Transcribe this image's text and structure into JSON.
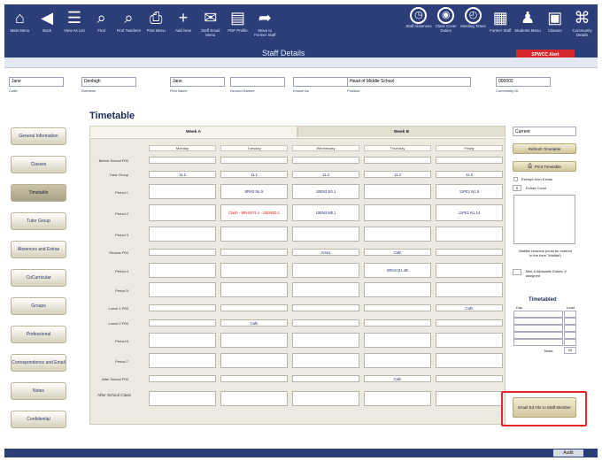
{
  "toolbar": {
    "buttons": [
      {
        "label": "Main Menu",
        "icon": "home-icon"
      },
      {
        "label": "Back",
        "icon": "back-icon"
      },
      {
        "label": "View As List",
        "icon": "list-icon"
      },
      {
        "label": "Find",
        "icon": "search-icon"
      },
      {
        "label": "Find Teachers",
        "icon": "search-plus-icon"
      },
      {
        "label": "Print Menu",
        "icon": "print-icon"
      },
      {
        "label": "Add New",
        "icon": "plus-icon"
      },
      {
        "label": "Staff Email Menu",
        "icon": "mail-icon"
      },
      {
        "label": "PDF Profile",
        "icon": "pdf-icon"
      },
      {
        "label": "Move to Former Staff",
        "icon": "share-arrow-icon"
      },
      {
        "label": "Staff Absences",
        "icon": "clock-icon"
      },
      {
        "label": "Class Cover Duties",
        "icon": "globe-icon"
      },
      {
        "label": "Meeting Times",
        "icon": "meeting-clock-icon"
      },
      {
        "label": "Former Staff",
        "icon": "former-staff-icon"
      },
      {
        "label": "Students Menu",
        "icon": "students-icon"
      },
      {
        "label": "Classes",
        "icon": "classes-icon"
      },
      {
        "label": "Community Details",
        "icon": "community-icon"
      }
    ],
    "title": "Staff Details",
    "alert_label": "SPWCC Alert"
  },
  "header": {
    "fields": [
      {
        "value": "Jane",
        "caption": "Code"
      },
      {
        "value": "Denbigh",
        "caption": "Surname"
      },
      {
        "value": "Jane",
        "caption": "First Name"
      },
      {
        "value": "",
        "caption": "Second Names"
      },
      {
        "value": "",
        "caption": "Known As"
      },
      {
        "value": "Head of Middle School",
        "caption": "Position"
      },
      {
        "value": "000002",
        "caption": "Community ID"
      }
    ]
  },
  "sidebar": {
    "items": [
      {
        "label": "General Information"
      },
      {
        "label": "Classes"
      },
      {
        "label": "Timetable"
      },
      {
        "label": "Tutor Group"
      },
      {
        "label": "Absences and Extras"
      },
      {
        "label": "CoCurricular"
      },
      {
        "label": "Groups"
      },
      {
        "label": "Professional"
      },
      {
        "label": "Correspondence and Email"
      },
      {
        "label": "Notes"
      },
      {
        "label": "Confidential"
      }
    ]
  },
  "timetable": {
    "title": "Timetable",
    "week_tabs": [
      "Week A",
      "Week B"
    ],
    "days": [
      "Monday",
      "Tuesday",
      "Wednesday",
      "Thursday",
      "Friday"
    ],
    "rows": [
      {
        "label": "Before School P00",
        "cells": [
          "",
          "",
          "",
          "",
          ""
        ]
      },
      {
        "label": "Tutor Group",
        "cells": [
          "11.2",
          "11.1",
          "11.2",
          "11.2",
          "11.2"
        ]
      },
      {
        "label": "Period 1",
        "cells": [
          "",
          "8RH2 NL.5",
          "10EN3 E0.1",
          "",
          "11PE1 N1.5"
        ]
      },
      {
        "label": "Period 2",
        "cells": [
          "",
          "Clash - 8RH3 P2.4 - 10EN3D.1",
          "10EN3 M0.1",
          "",
          "11PE1 N1.14"
        ]
      },
      {
        "label": "Period 3",
        "cells": [
          "",
          "",
          "",
          "",
          ""
        ]
      },
      {
        "label": "Recess P00",
        "cells": [
          "",
          "",
          "Area1",
          "Cafe",
          ""
        ]
      },
      {
        "label": "Period 4",
        "cells": [
          "",
          "",
          "",
          "8RH3 Q1.4B",
          ""
        ]
      },
      {
        "label": "Period 5",
        "cells": [
          "",
          "",
          "",
          "",
          ""
        ]
      },
      {
        "label": "Lunch 1 P00",
        "cells": [
          "",
          "",
          "",
          "",
          "Cafe"
        ]
      },
      {
        "label": "Lunch 2 P00",
        "cells": [
          "",
          "Cafe",
          "",
          "",
          ""
        ]
      },
      {
        "label": "Period 6",
        "cells": [
          "",
          "",
          "",
          "",
          ""
        ]
      },
      {
        "label": "Period 7",
        "cells": [
          "",
          "",
          "",
          "",
          ""
        ]
      },
      {
        "label": "After School P00",
        "cells": [
          "",
          "",
          "",
          "Cafe",
          ""
        ]
      },
      {
        "label": "After School Class",
        "cells": [
          "",
          "",
          "",
          "",
          ""
        ]
      }
    ]
  },
  "right_panel": {
    "current_value": "Current",
    "refresh_label": "Refresh Timetable",
    "print_label": "Print Timetable",
    "exempt_label": "Exempt from Extras",
    "extras_count_label": "Extras Count",
    "extras_count_value": "0",
    "note_text": "Waitlist Lessons (must be entered in the form 'Waitlist')",
    "max_label": "Max # Allowable Duties: if assigned",
    "timetabled_title": "Timetabled",
    "col_day": "Day",
    "col_load": "Load",
    "totals_label": "Totals",
    "totals_value": "10",
    "email_button_label": "Email Ed File to Staff Member"
  },
  "footer": {
    "audit_label": "Audit"
  }
}
